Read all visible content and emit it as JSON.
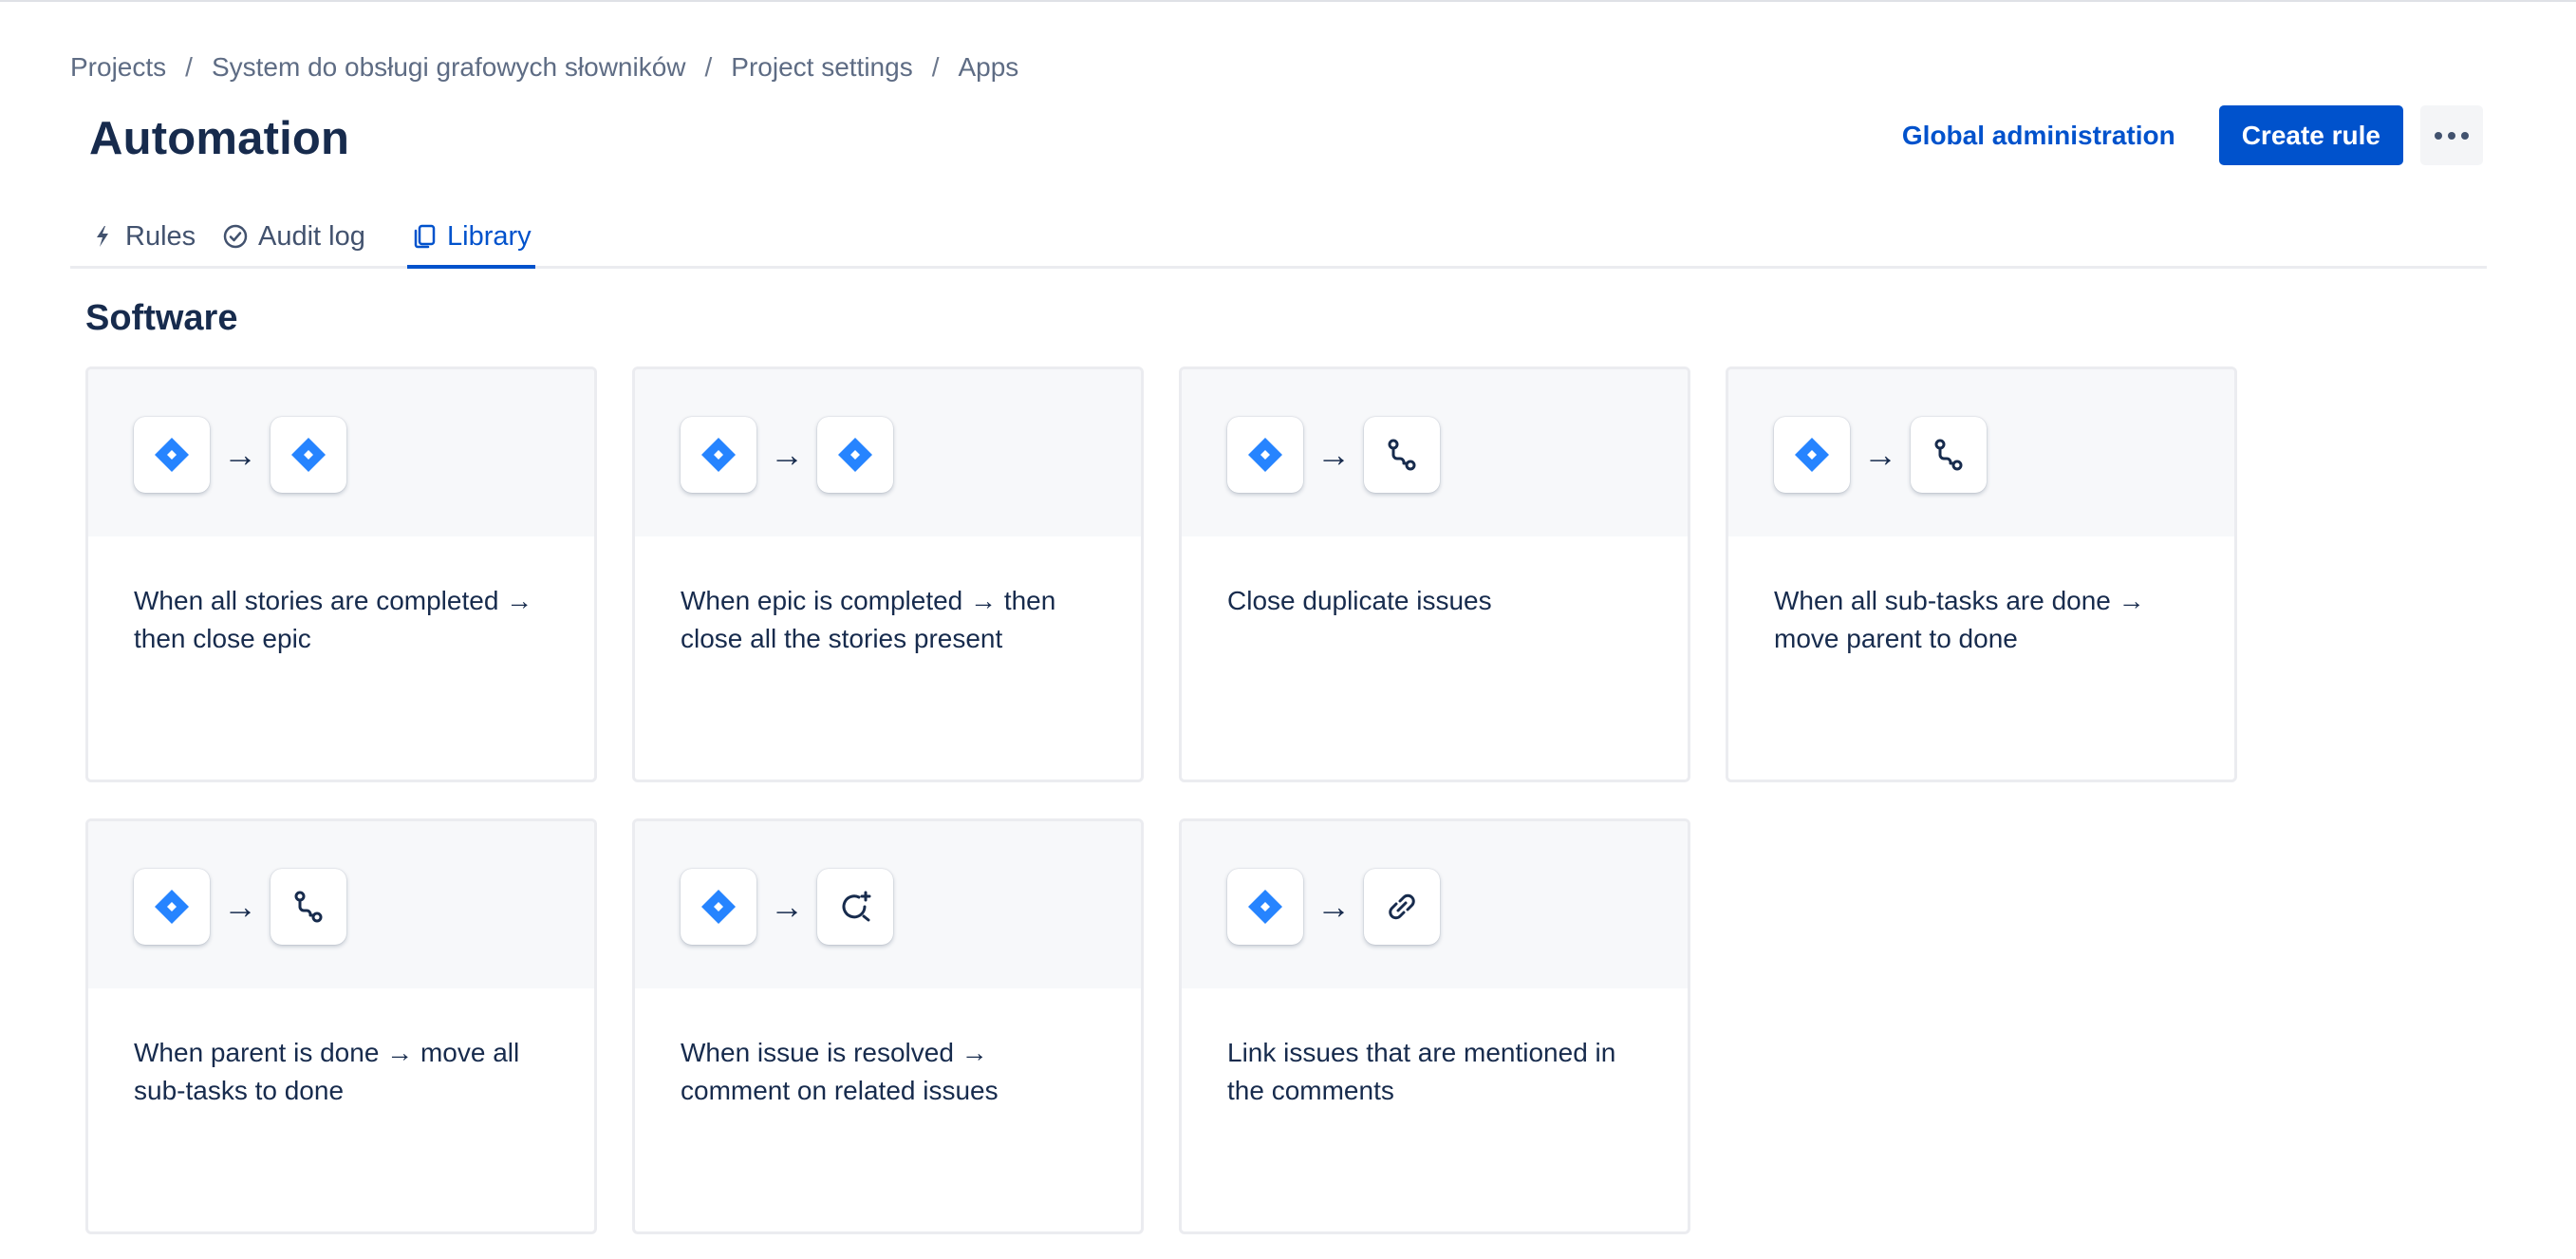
{
  "breadcrumb": {
    "items": [
      "Projects",
      "System do obsługi grafowych słowników",
      "Project settings",
      "Apps"
    ],
    "separator": "/"
  },
  "header": {
    "title": "Automation",
    "global_admin_label": "Global administration",
    "create_rule_label": "Create rule",
    "more_icon": "more-horizontal-icon"
  },
  "tabs": [
    {
      "label": "Rules",
      "icon": "lightning-icon",
      "active": false
    },
    {
      "label": "Audit log",
      "icon": "check-circle-icon",
      "active": false
    },
    {
      "label": "Library",
      "icon": "copy-icon",
      "active": true
    }
  ],
  "section": {
    "title": "Software"
  },
  "cards": [
    {
      "text": "When all stories are completed → then close epic",
      "trigger_icon": "jira-diamond-icon",
      "action_icon": "jira-diamond-icon"
    },
    {
      "text": "When epic is completed → then close all the stories present",
      "trigger_icon": "jira-diamond-icon",
      "action_icon": "jira-diamond-icon"
    },
    {
      "text": "Close duplicate issues",
      "trigger_icon": "jira-diamond-icon",
      "action_icon": "transition-icon"
    },
    {
      "text": "When all sub-tasks are done → move parent to done",
      "trigger_icon": "jira-diamond-icon",
      "action_icon": "transition-icon"
    },
    {
      "text": "When parent is done → move all sub-tasks to done",
      "trigger_icon": "jira-diamond-icon",
      "action_icon": "transition-icon"
    },
    {
      "text": "When issue is resolved → comment on related issues",
      "trigger_icon": "jira-diamond-icon",
      "action_icon": "comment-add-icon"
    },
    {
      "text": "Link issues that are mentioned in the comments",
      "trigger_icon": "jira-diamond-icon",
      "action_icon": "link-icon"
    }
  ],
  "arrow_glyph": "→",
  "colors": {
    "primary": "#0052cc",
    "text": "#172b4d",
    "subtle_text": "#5e6c84",
    "jira_blue": "#2684ff"
  }
}
